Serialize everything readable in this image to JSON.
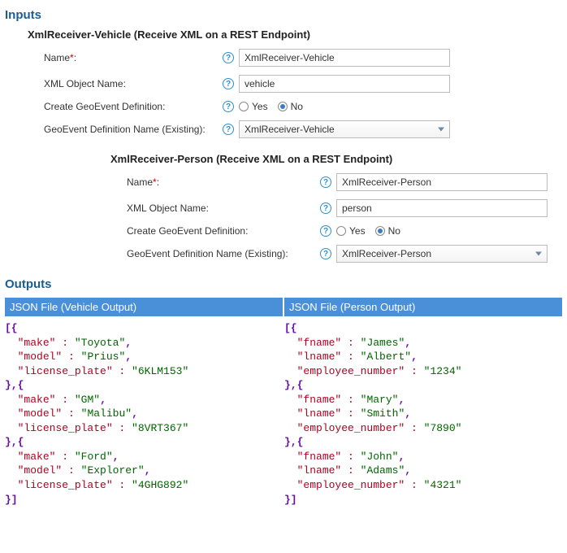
{
  "inputs_heading": "Inputs",
  "outputs_heading": "Outputs",
  "form1": {
    "title": "XmlReceiver-Vehicle (Receive XML on a REST Endpoint)",
    "name_label": "Name",
    "name_value": "XmlReceiver-Vehicle",
    "xml_label": "XML Object Name:",
    "xml_value": "vehicle",
    "create_label": "Create GeoEvent Definition:",
    "yes_label": "Yes",
    "no_label": "No",
    "create_value": "No",
    "defname_label": "GeoEvent Definition Name (Existing):",
    "defname_value": "XmlReceiver-Vehicle"
  },
  "form2": {
    "title": "XmlReceiver-Person (Receive XML on a REST Endpoint)",
    "name_label": "Name",
    "name_value": "XmlReceiver-Person",
    "xml_label": "XML Object Name:",
    "xml_value": "person",
    "create_label": "Create GeoEvent Definition:",
    "yes_label": "Yes",
    "no_label": "No",
    "create_value": "No",
    "defname_label": "GeoEvent Definition Name (Existing):",
    "defname_value": "XmlReceiver-Person"
  },
  "output_vehicle": {
    "header": "JSON File (Vehicle Output)",
    "records": [
      {
        "make": "Toyota",
        "model": "Prius",
        "license_plate": "6KLM153"
      },
      {
        "make": "GM",
        "model": "Malibu",
        "license_plate": "8VRT367"
      },
      {
        "make": "Ford",
        "model": "Explorer",
        "license_plate": "4GHG892"
      }
    ]
  },
  "output_person": {
    "header": "JSON File (Person Output)",
    "records": [
      {
        "fname": "James",
        "lname": "Albert",
        "employee_number": "1234"
      },
      {
        "fname": "Mary",
        "lname": "Smith",
        "employee_number": "7890"
      },
      {
        "fname": "John",
        "lname": "Adams",
        "employee_number": "4321"
      }
    ]
  }
}
